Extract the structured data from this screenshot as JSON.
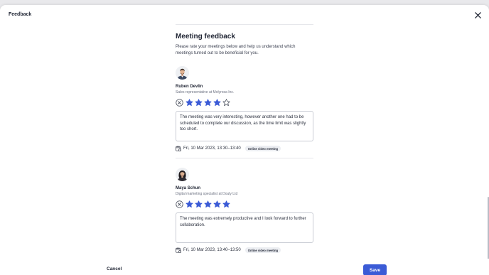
{
  "dialog": {
    "title": "Feedback",
    "close_icon": "close-icon"
  },
  "section": {
    "title": "Meeting feedback",
    "description": "Please rate your meetings below and help us understand which meetings turned out to be beneficial for you."
  },
  "meetings": [
    {
      "name": "Ruben Devlin",
      "role": "Sales representative at Molyrosa Inc.",
      "rating": 4,
      "max_rating": 5,
      "comment": "The meeting was very interesting, however another one had to be scheduled to complete our discussion, as the time limit was slightly too short.",
      "date": "Fri, 10 Mar 2023, 13:30–13:40",
      "type": "Online video meeting"
    },
    {
      "name": "Maya Schun",
      "role": "Digital marketing specialist at Douly Ltd",
      "rating": 5,
      "max_rating": 5,
      "comment": "The meeting was extremely productive and I look forward to further collaboration.",
      "date": "Fri, 10 Mar 2023, 13:40–13:50",
      "type": "Online video meeting"
    }
  ],
  "footer": {
    "cancel_label": "Cancel",
    "save_label": "Save"
  },
  "colors": {
    "accent": "#3b5bd6",
    "star_filled": "#3b5bd6",
    "star_empty_outline": "#3b4150"
  }
}
